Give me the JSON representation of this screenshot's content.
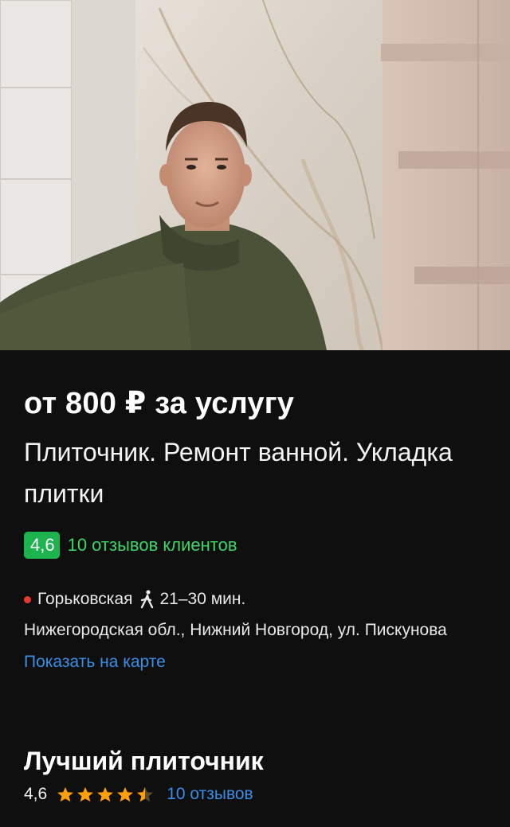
{
  "listing": {
    "price": "от 800 ₽ за услугу",
    "title": "Плиточник. Ремонт ванной. Укладка плитки"
  },
  "rating": {
    "score": "4,6",
    "reviews_text": "10 отзывов клиентов"
  },
  "location": {
    "metro": "Горьковская",
    "metro_color": "#e53a2f",
    "walk_icon": "walking-person-icon",
    "walk_time": "21–30 мин.",
    "address": "Нижегородская обл., Нижний Новгород, ул. Пискунова",
    "map_link": "Показать на карте"
  },
  "pro": {
    "name": "Лучший плиточник",
    "score": "4,6",
    "stars": 4.5,
    "reviews_link": "10 отзывов"
  },
  "colors": {
    "accent_green": "#1db34f",
    "link_blue": "#3a8ee6",
    "star_orange": "#ff9f0a"
  }
}
